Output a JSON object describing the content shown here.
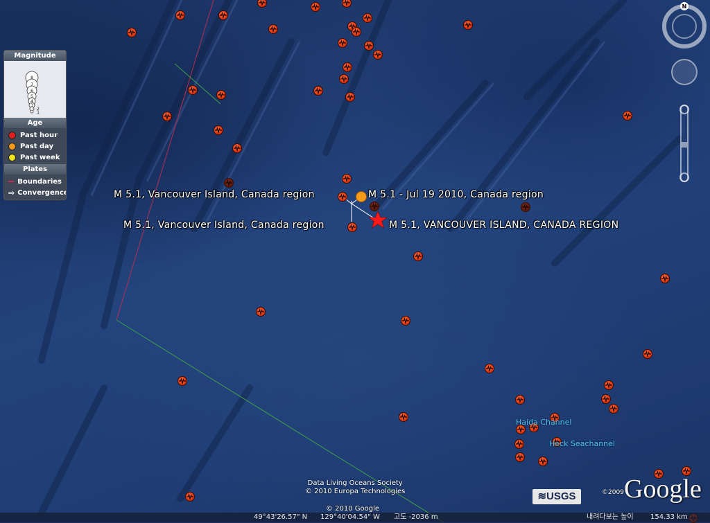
{
  "legend": {
    "magnitude_title": "Magnitude",
    "magnitude_scale": [
      "8",
      "7",
      "6",
      "5",
      "4",
      "3",
      "2",
      "1"
    ],
    "age_title": "Age",
    "age_items": [
      {
        "label": "Past hour",
        "color": "#e02020"
      },
      {
        "label": "Past day",
        "color": "#f59a1a"
      },
      {
        "label": "Past week",
        "color": "#f2e61a"
      }
    ],
    "plates_title": "Plates",
    "plates_items": [
      {
        "label": "Boundaries",
        "color": "#c0304a"
      },
      {
        "label": "Convergence",
        "color": "#ffffff"
      }
    ]
  },
  "labels": {
    "quake_a": "M 5.1, Vancouver Island, Canada region",
    "quake_b": "M 5.1 - Jul 19 2010, Canada region",
    "quake_c": "M 5.1, Vancouver Island, Canada region",
    "quake_d": "M 5.1, VANCOUVER ISLAND, CANADA REGION"
  },
  "places": {
    "haida": "Haida Channel",
    "heck": "Heck Seachannel"
  },
  "attribution": {
    "line1": "Data Living Oceans Society",
    "line2": "© 2010 Europa Technologies",
    "line3": "© 2010 Google",
    "usgs": "≋USGS",
    "google_copy": "©2009",
    "google_logo": "Google"
  },
  "status": {
    "lat": "49°43'26.57\" N",
    "lon": "129°40'04.54\" W",
    "elev": "고도 -2036 m",
    "eye": "내려다보는 높이",
    "eye_value": "154.33 km"
  },
  "nav": {
    "north": "N"
  },
  "colors": {
    "ocean": "#1f3d74",
    "quake": "#e33a12",
    "star": "#ff1a1a",
    "past_day": "#f59a1a"
  }
}
